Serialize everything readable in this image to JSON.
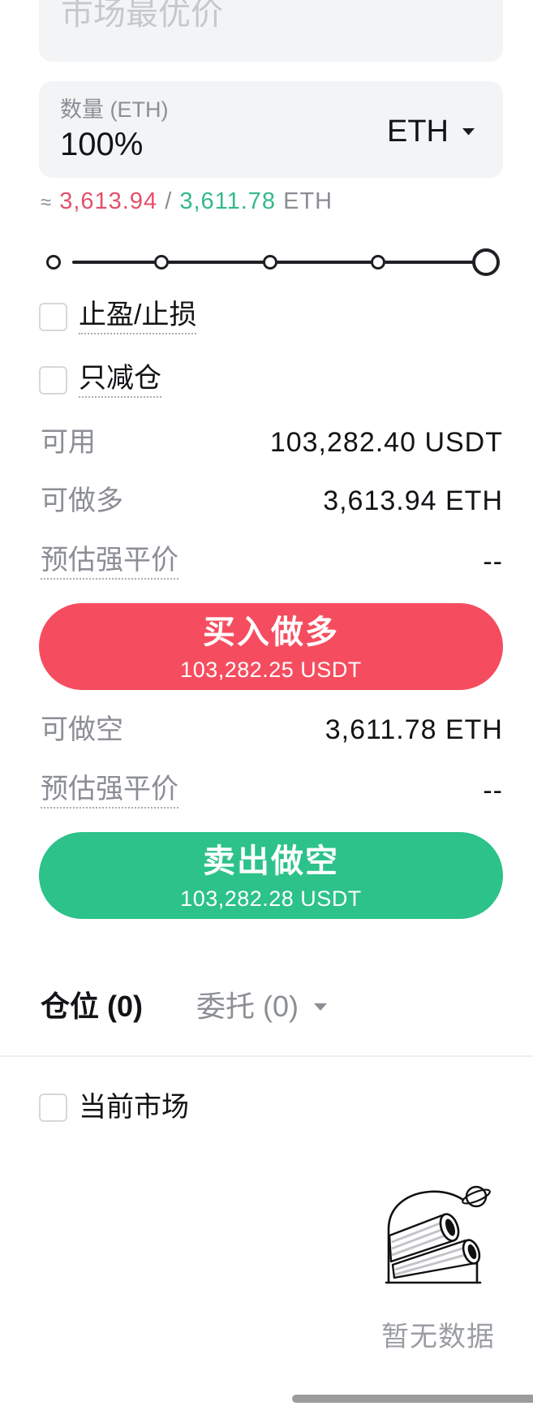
{
  "price_field": {
    "placeholder": "市场最优价"
  },
  "quantity_field": {
    "label": "数量 (ETH)",
    "value": "100%",
    "unit_selector": {
      "selected": "ETH",
      "icon": "caret-down-icon"
    }
  },
  "estimate": {
    "approx_sign": "≈",
    "long_max": "3,613.94",
    "separator": "/",
    "short_max": "3,611.78",
    "unit": "ETH"
  },
  "slider": {
    "value_percent": 100,
    "stops_percent": [
      0,
      25,
      50,
      75,
      100
    ]
  },
  "options": [
    {
      "label": "止盈/止损",
      "checked": false
    },
    {
      "label": "只减仓",
      "checked": false
    }
  ],
  "available": {
    "label": "可用",
    "value": "103,282.40 USDT"
  },
  "long": {
    "max_label": "可做多",
    "max_value": "3,613.94 ETH",
    "liq_label": "预估强平价",
    "liq_value": "--",
    "button_label": "买入做多",
    "button_price": "103,282.25 USDT"
  },
  "short": {
    "max_label": "可做空",
    "max_value": "3,611.78 ETH",
    "liq_label": "预估强平价",
    "liq_value": "--",
    "button_label": "卖出做空",
    "button_price": "103,282.28 USDT"
  },
  "bottom_tabs": [
    {
      "label": "仓位 (0)",
      "active": true
    },
    {
      "label": "委托 (0)",
      "active": false,
      "icon": "caret-down-icon"
    }
  ],
  "filter": {
    "label": "当前市场",
    "checked": false
  },
  "empty_state": {
    "text": "暂无数据",
    "illustration": "binoculars-observatory-icon"
  },
  "colors": {
    "buy": "#f54d5f",
    "sell": "#2cc28a",
    "buy_text": "#e4506a",
    "sell_text": "#33b98b",
    "muted": "#8b8e95",
    "field_bg": "#f3f4f6"
  }
}
